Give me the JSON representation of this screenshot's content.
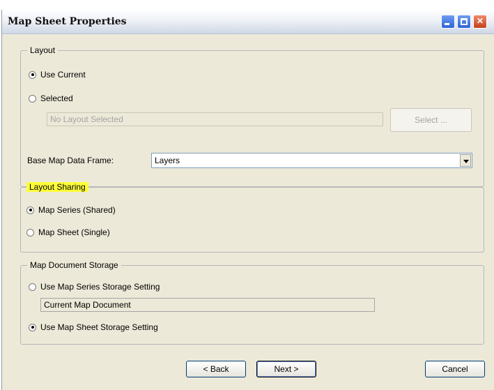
{
  "window": {
    "title": "Map Sheet Properties",
    "controls": {
      "minimize": "minimize-icon",
      "maximize": "maximize-icon",
      "close": "close-icon"
    }
  },
  "layout_group": {
    "legend": "Layout",
    "use_current_label": "Use Current",
    "use_current_checked": true,
    "selected_label": "Selected",
    "selected_checked": false,
    "layout_field_value": "No Layout Selected",
    "select_button_label": "Select ...",
    "base_map_label": "Base Map Data Frame:",
    "base_map_value": "Layers"
  },
  "sharing_group": {
    "legend": "Layout Sharing",
    "highlight_color": "#ffff38",
    "map_series_label": "Map Series (Shared)",
    "map_series_checked": true,
    "map_sheet_label": "Map Sheet (Single)",
    "map_sheet_checked": false
  },
  "storage_group": {
    "legend": "Map Document Storage",
    "series_setting_label": "Use Map Series Storage Setting",
    "series_setting_checked": false,
    "storage_field_value": "Current Map Document",
    "sheet_setting_label": "Use Map Sheet Storage Setting",
    "sheet_setting_checked": true
  },
  "footer": {
    "back_label": "< Back",
    "next_label": "Next >",
    "cancel_label": "Cancel"
  }
}
